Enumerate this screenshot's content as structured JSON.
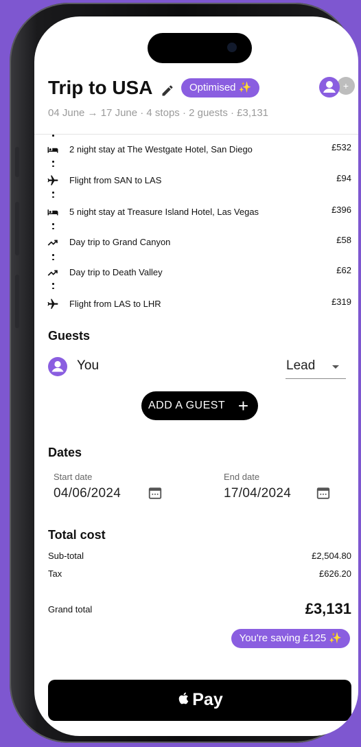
{
  "trip": {
    "title": "Trip to USA",
    "badge": "Optimised ✨",
    "subtitle": "04 June → 17 June · 4 stops · 2 guests · £3,131",
    "avatar_extra": "+"
  },
  "stops": [
    {
      "icon": "bed-icon",
      "label": "2 night stay at The Westgate Hotel, San Diego",
      "price": "£532"
    },
    {
      "icon": "flight-icon",
      "label": "Flight from SAN to LAS",
      "price": "£94"
    },
    {
      "icon": "bed-icon",
      "label": "5 night stay at Treasure Island Hotel, Las Vegas",
      "price": "£396"
    },
    {
      "icon": "trending-icon",
      "label": "Day trip to Grand Canyon",
      "price": "£58"
    },
    {
      "icon": "trending-icon",
      "label": "Day trip to Death Valley",
      "price": "£62"
    },
    {
      "icon": "flight-icon",
      "label": "Flight from LAS to LHR",
      "price": "£319"
    }
  ],
  "guests": {
    "heading": "Guests",
    "items": [
      {
        "name": "You",
        "role": "Lead"
      }
    ],
    "add_label": "ADD A GUEST",
    "add_icon": "+"
  },
  "dates": {
    "heading": "Dates",
    "start_label": "Start date",
    "start_value": "04/06/2024",
    "end_label": "End date",
    "end_value": "17/04/2024"
  },
  "cost": {
    "heading": "Total cost",
    "subtotal_label": "Sub-total",
    "subtotal_value": "£2,504.80",
    "tax_label": "Tax",
    "tax_value": "£626.20",
    "grand_label": "Grand total",
    "grand_value": "£3,131",
    "saving": "You're saving £125 ✨"
  },
  "pay": {
    "label": "Pay"
  },
  "colors": {
    "background": "#7e57d0",
    "accent": "#8a5ee0",
    "text": "#111111",
    "muted": "#9a9a9a"
  }
}
